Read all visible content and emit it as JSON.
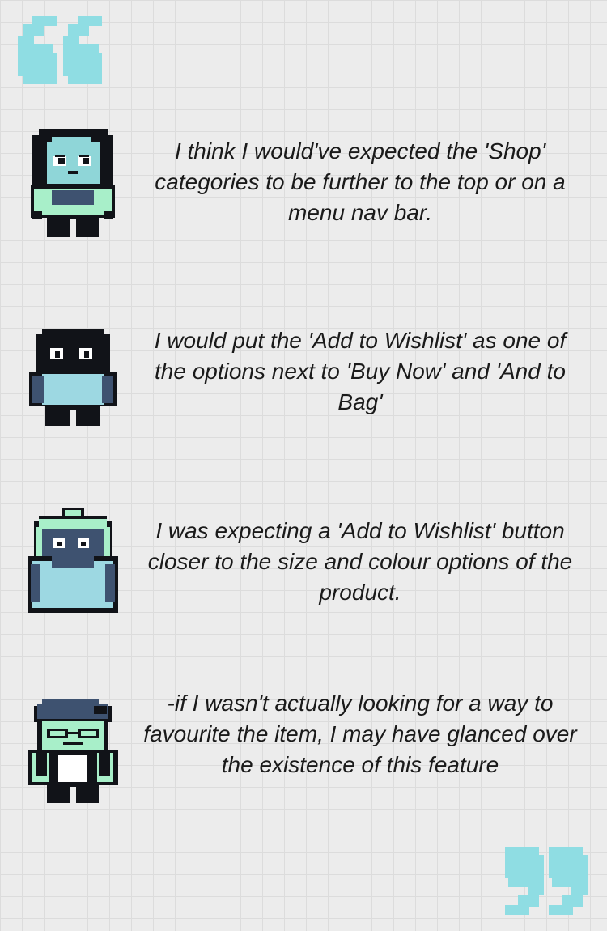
{
  "colors": {
    "background": "#ececec",
    "quote_mark": "#8fdde3",
    "text": "#1a1a1a",
    "mint": "#a8efc9",
    "light_blue": "#9dd8e2",
    "navy": "#3e5270",
    "dark": "#111318"
  },
  "icons": {
    "open_quote": "opening-quotation-mark-icon",
    "close_quote": "closing-quotation-mark-icon"
  },
  "testimonials": [
    {
      "avatar": "girl-character-avatar",
      "text": "I think I would've expected the 'Shop' categories to be further to the top or on a menu nav bar."
    },
    {
      "avatar": "ninja-character-avatar",
      "text": "I would put the 'Add to Wishlist' as one of the options next to 'Buy Now' and 'And to Bag'"
    },
    {
      "avatar": "hooded-character-avatar",
      "text": "I was expecting a 'Add to Wishlist' button closer to the size and colour options of the product."
    },
    {
      "avatar": "glasses-character-avatar",
      "text": "-if I wasn't actually looking for a way to favourite the item, I may have glanced over the existence of this feature"
    }
  ]
}
